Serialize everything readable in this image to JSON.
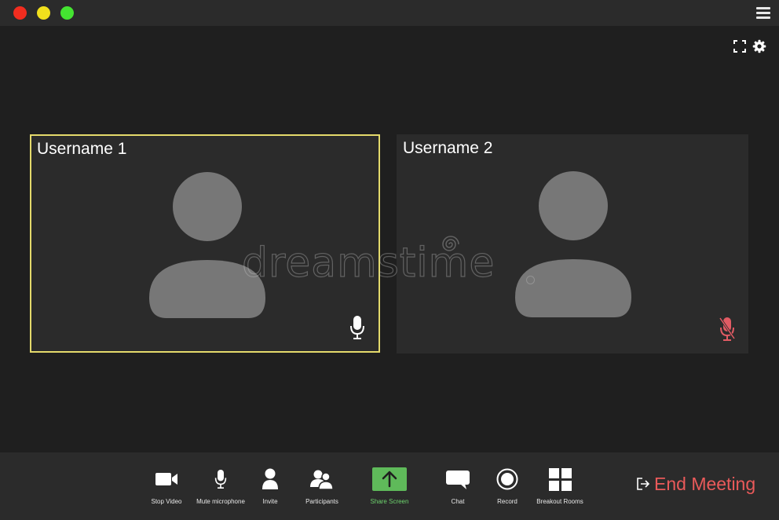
{
  "window": {
    "controls": [
      "close",
      "minimize",
      "maximize"
    ],
    "colors": {
      "close": "#f22d1f",
      "minimize": "#f1e01c",
      "maximize": "#44e431"
    }
  },
  "header": {
    "icons": [
      "menu-icon",
      "fullscreen-icon",
      "gear-icon"
    ]
  },
  "participants": [
    {
      "name": "Username 1",
      "active": true,
      "mic": "on",
      "mic_color": "#ffffff"
    },
    {
      "name": "Username 2",
      "active": false,
      "mic": "muted",
      "mic_color": "#e25b64"
    }
  ],
  "watermark": {
    "text": "dreamstime"
  },
  "toolbar": {
    "buttons": [
      {
        "label": "Stop Video",
        "icon": "video-camera-icon"
      },
      {
        "label": "Mute microphone",
        "icon": "microphone-icon"
      },
      {
        "label": "Invite",
        "icon": "person-icon"
      },
      {
        "label": "Participants",
        "icon": "participants-icon"
      },
      {
        "label": "Share Screen",
        "icon": "share-screen-icon",
        "color": "#5fba5a"
      },
      {
        "label": "Chat",
        "icon": "chat-icon"
      },
      {
        "label": "Record",
        "icon": "record-icon"
      },
      {
        "label": "Breakout Rooms",
        "icon": "breakout-rooms-icon"
      }
    ],
    "end_meeting": {
      "label": "End Meeting",
      "color": "#ea5a5a",
      "icon": "exit-icon"
    }
  },
  "colors": {
    "background": "#1f1f1f",
    "panel": "#2b2b2b",
    "active_border": "#e4da6b",
    "avatar": "#777777"
  }
}
